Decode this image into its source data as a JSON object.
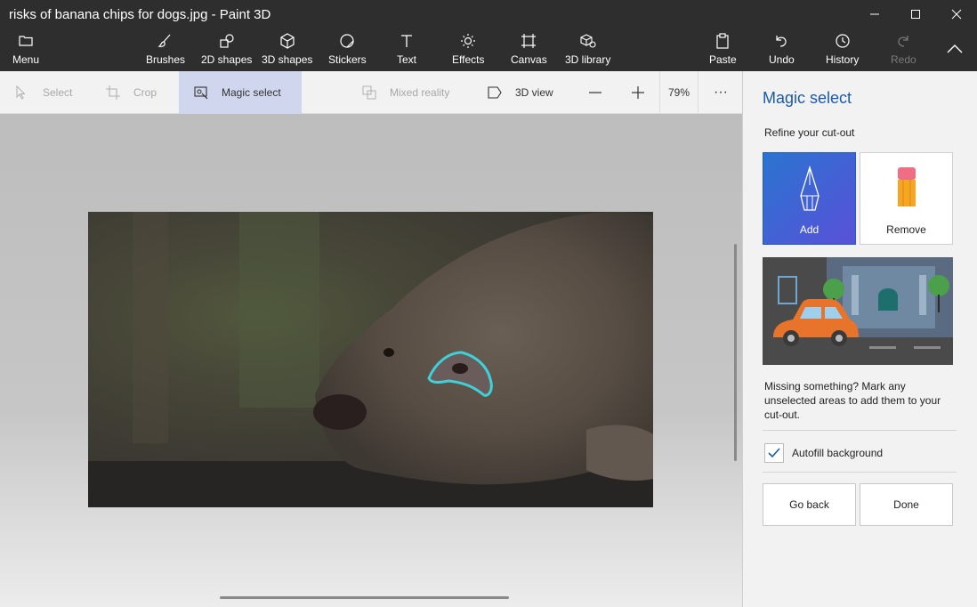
{
  "window": {
    "title": "risks of banana chips for dogs.jpg - Paint 3D",
    "controls": [
      "minimize",
      "maximize",
      "close"
    ]
  },
  "ribbon": {
    "menu_label": "Menu",
    "items": [
      {
        "label": "Brushes",
        "icon": "brush-icon"
      },
      {
        "label": "2D shapes",
        "icon": "2d-shapes-icon"
      },
      {
        "label": "3D shapes",
        "icon": "3d-shapes-icon"
      },
      {
        "label": "Stickers",
        "icon": "stickers-icon"
      },
      {
        "label": "Text",
        "icon": "text-icon"
      },
      {
        "label": "Effects",
        "icon": "effects-icon"
      },
      {
        "label": "Canvas",
        "icon": "canvas-icon"
      },
      {
        "label": "3D library",
        "icon": "3d-library-icon"
      }
    ],
    "right_items": [
      {
        "label": "Paste",
        "icon": "paste-icon"
      },
      {
        "label": "Undo",
        "icon": "undo-icon"
      },
      {
        "label": "History",
        "icon": "history-icon"
      },
      {
        "label": "Redo",
        "icon": "redo-icon",
        "disabled": true
      }
    ]
  },
  "toolbar": {
    "select": "Select",
    "crop": "Crop",
    "magic_select": "Magic select",
    "mixed_reality": "Mixed reality",
    "view_3d": "3D view",
    "zoom": "79%",
    "more": "···"
  },
  "panel": {
    "title": "Magic select",
    "subtitle": "Refine your cut-out",
    "add_label": "Add",
    "remove_label": "Remove",
    "description": "Missing something? Mark any unselected areas to add them to your cut-out.",
    "autofill_label": "Autofill background",
    "autofill_checked": true,
    "go_back": "Go back",
    "done": "Done"
  },
  "colors": {
    "accent": "#1a5aa8",
    "selection_outline": "#3fd0d8"
  }
}
